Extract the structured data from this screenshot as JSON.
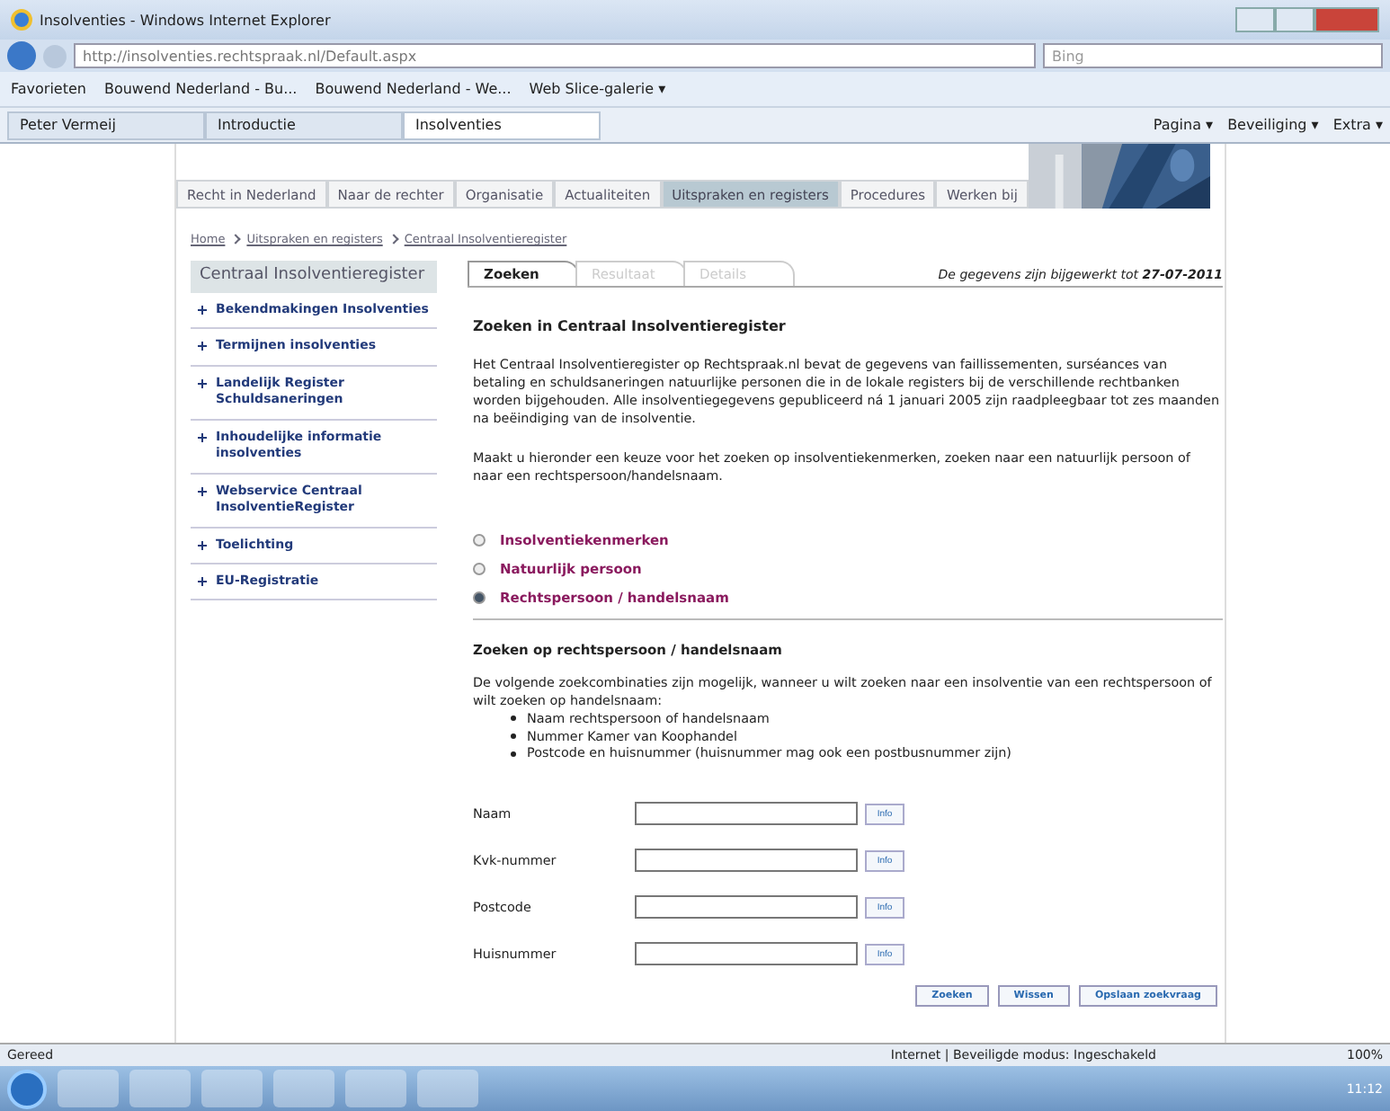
{
  "browser": {
    "title": "Insolventies - Windows Internet Explorer",
    "address": "http://insolventies.rechtspraak.nl/Default.aspx",
    "search_placeholder": "Bing",
    "favorites_label": "Favorieten",
    "favorites": [
      "Bouwend Nederland - Bu...",
      "Bouwend Nederland - We...",
      "Web Slice-galerie ▾"
    ],
    "tabs": [
      {
        "label": "Peter Vermeij",
        "selected": false
      },
      {
        "label": "Introductie",
        "selected": false
      },
      {
        "label": "Insolventies",
        "selected": true
      }
    ],
    "commands": [
      "Pagina ▾",
      "Beveiliging ▾",
      "Extra ▾"
    ],
    "status": "Gereed",
    "zone": "Internet | Beveiligde modus: Ingeschakeld",
    "zoom": "100%",
    "clock": "11:12"
  },
  "nav": [
    {
      "label": "Recht in Nederland",
      "selected": false
    },
    {
      "label": "Naar de rechter",
      "selected": false
    },
    {
      "label": "Organisatie",
      "selected": false
    },
    {
      "label": "Actualiteiten",
      "selected": false
    },
    {
      "label": "Uitspraken en registers",
      "selected": true
    },
    {
      "label": "Procedures",
      "selected": false
    },
    {
      "label": "Werken bij",
      "selected": false
    }
  ],
  "breadcrumb": [
    "Home",
    "Uitspraken en registers",
    "Centraal Insolventieregister"
  ],
  "sidebar": {
    "title": "Centraal Insolventieregister",
    "items": [
      "Bekendmakingen Insolventies",
      "Termijnen insolventies",
      "Landelijk Register Schuldsaneringen",
      "Inhoudelijke informatie insolventies",
      "Webservice Centraal InsolventieRegister",
      "Toelichting",
      "EU-Registratie"
    ]
  },
  "content_tabs": [
    {
      "label": "Zoeken",
      "selected": true,
      "disabled": false
    },
    {
      "label": "Resultaat",
      "selected": false,
      "disabled": true
    },
    {
      "label": "Details",
      "selected": false,
      "disabled": true
    }
  ],
  "updated": "De gegevens zijn bijgewerkt tot **27-07-2011**",
  "heading": "Zoeken in Centraal Insolventieregister",
  "paragraphs": [
    "Het Centraal Insolventieregister op Rechtspraak.nl bevat de gegevens van faillissementen, surséances van betaling en schuldsaneringen natuurlijke personen die in de lokale registers bij de verschillende rechtbanken worden bijgehouden. Alle insolventiegegevens gepubliceerd ná 1 januari 2005 zijn raadpleegbaar tot zes maanden na beëindiging van de insolventie.",
    "Maakt u hieronder een keuze voor het zoeken op insolventiekenmerken, zoeken naar een natuurlijk persoon of naar een rechtspersoon/handelsnaam."
  ],
  "search_types": [
    {
      "label": "Insolventiekenmerken",
      "selected": false
    },
    {
      "label": "Natuurlijk persoon",
      "selected": false
    },
    {
      "label": "Rechtspersoon / handelsnaam",
      "selected": true
    }
  ],
  "section": {
    "heading": "Zoeken op rechtspersoon / handelsnaam",
    "intro": "De volgende zoekcombinaties zijn mogelijk, wanneer u wilt zoeken naar een insolventie van een rechtspersoon of wilt zoeken op handelsnaam:",
    "bullets": [
      "Naam rechtspersoon of handelsnaam",
      "Nummer Kamer van Koophandel",
      "Postcode en huisnummer (huisnummer mag ook een postbusnummer zijn)"
    ]
  },
  "fields": [
    {
      "label": "Naam",
      "info": "Info"
    },
    {
      "label": "Kvk-nummer",
      "info": "Info"
    },
    {
      "label": "Postcode",
      "info": "Info"
    },
    {
      "label": "Huisnummer",
      "info": "Info"
    }
  ],
  "buttons": [
    "Zoeken",
    "Wissen",
    "Opslaan zoekvraag"
  ]
}
